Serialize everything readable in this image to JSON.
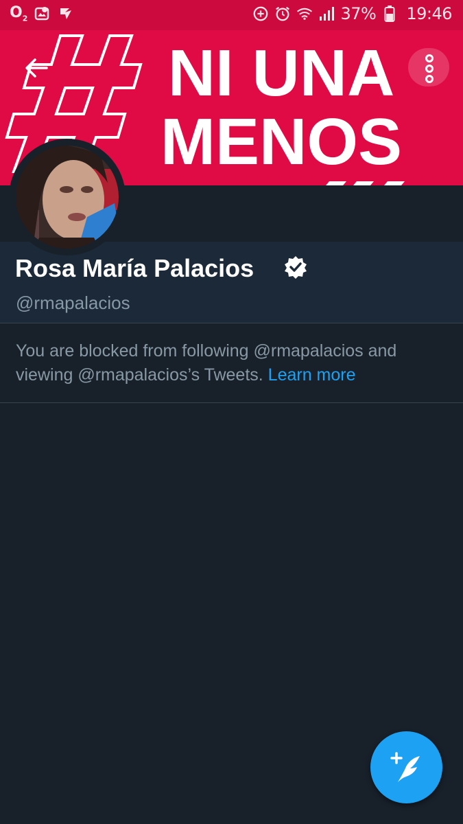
{
  "status_bar": {
    "carrier": "O",
    "carrier_sub": "2",
    "battery_percent": "37%",
    "time": "19:46",
    "icons": [
      "gallery-icon",
      "checkmark-app-icon",
      "data-saver-icon",
      "alarm-icon",
      "wifi-icon",
      "signal-icon",
      "battery-icon"
    ]
  },
  "header": {
    "banner_text_line1": "NI UNA",
    "banner_text_line2": "MENOS",
    "banner_symbol": "#",
    "banner_color": "#e00a45",
    "back_icon": "arrow-left-icon",
    "menu_icon": "more-vertical-icon"
  },
  "profile": {
    "display_name": "Rosa María Palacios",
    "verified_icon": "verified-badge-icon",
    "handle": "@rmapalacios"
  },
  "blocked_notice": {
    "text": "You are blocked from following @rmapalacios and viewing @rmapalacios’s Tweets.",
    "link_label": "Learn more",
    "link_color": "#1da1f2"
  },
  "fab": {
    "icon": "compose-tweet-icon",
    "color": "#1da1f2"
  }
}
